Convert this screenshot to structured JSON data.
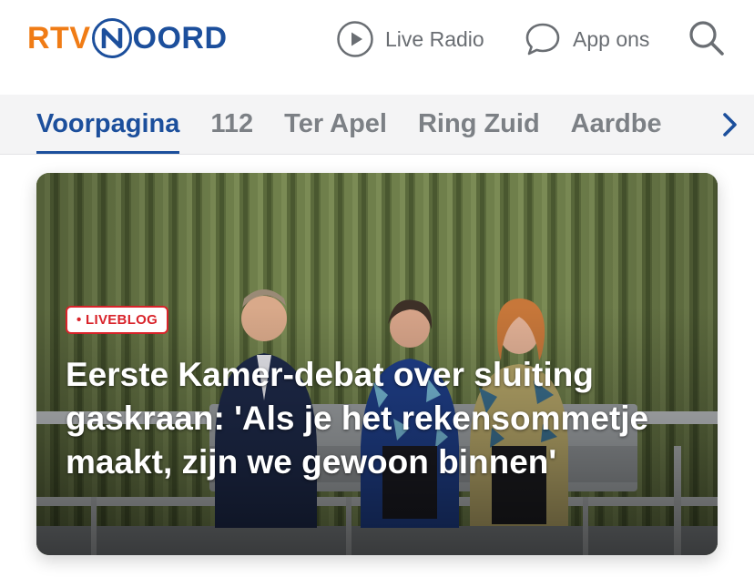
{
  "header": {
    "logo": {
      "text_left": "RTV",
      "text_right": "OORD"
    },
    "live_radio_label": "Live Radio",
    "app_label": "App ons",
    "search_icon": "search-icon"
  },
  "tabs": [
    {
      "label": "Voorpagina",
      "active": true
    },
    {
      "label": "112",
      "active": false
    },
    {
      "label": "Ter Apel",
      "active": false
    },
    {
      "label": "Ring Zuid",
      "active": false
    },
    {
      "label": "Aardbe",
      "active": false
    }
  ],
  "hero": {
    "badge": "• LIVEBLOG",
    "headline": "Eerste Kamer-debat over sluiting gaskraan: 'Als je het rekensommetje maakt, zijn we gewoon binnen'"
  },
  "colors": {
    "brand_blue": "#1c4f9c",
    "brand_orange": "#f07c16",
    "badge_red": "#d9232a",
    "muted_text": "#6a6e73"
  }
}
